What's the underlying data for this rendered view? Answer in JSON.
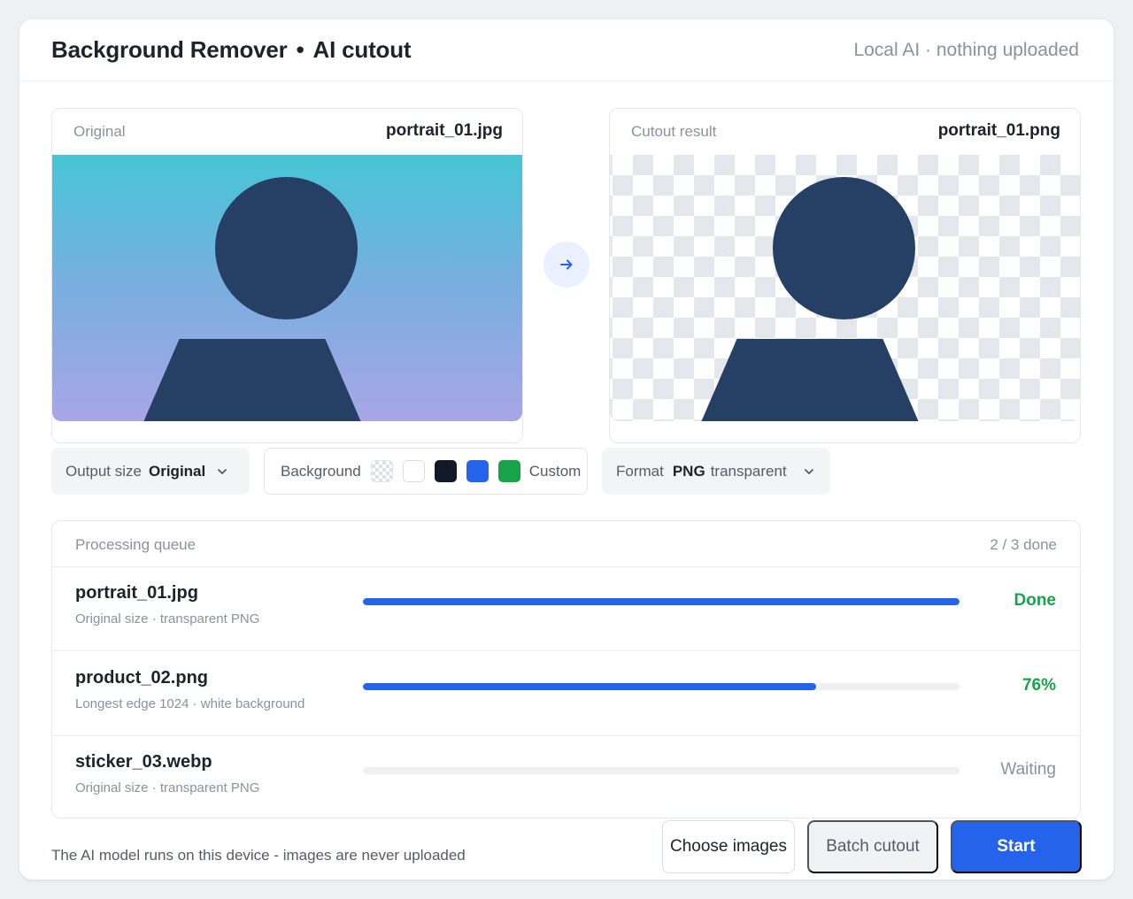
{
  "header": {
    "title": "Background Remover",
    "separator": "•",
    "subtitle": "AI cutout",
    "privacy": "Local AI · nothing uploaded"
  },
  "original_panel": {
    "label": "Original",
    "filename": "portrait_01.jpg"
  },
  "result_panel": {
    "label": "Cutout result",
    "filename": "portrait_01.png"
  },
  "controls": {
    "output_size": {
      "label": "Output size",
      "value": "Original"
    },
    "background": {
      "label": "Background",
      "swatches": [
        "transparent",
        "#ffffff",
        "#111827",
        "#2563eb",
        "#16a34a"
      ],
      "custom_label": "Custom"
    },
    "format": {
      "label": "Format",
      "value": "PNG",
      "sub": "transparent"
    }
  },
  "queue": {
    "title": "Processing queue",
    "count": "2 / 3 done",
    "items": [
      {
        "name": "portrait_01.jpg",
        "meta": "Original size · transparent PNG",
        "progress": 1.0,
        "status": "Done"
      },
      {
        "name": "product_02.png",
        "meta": "Longest edge 1024 · white background",
        "progress": 0.76,
        "status": "76%"
      },
      {
        "name": "sticker_03.webp",
        "meta": "Original size · transparent PNG",
        "progress": 0.0,
        "status": "Waiting"
      }
    ]
  },
  "footer": {
    "note": "The AI model runs on this device - images are never uploaded",
    "choose_label": "Choose images",
    "batch_label": "Batch cutout",
    "start_label": "Start"
  },
  "colors": {
    "accent": "#2563eb",
    "success": "#17a34a",
    "silhouette": "#263f64"
  },
  "icons": {
    "arrow": "arrow-right-icon",
    "dropdown": "chevron-down-icon"
  }
}
